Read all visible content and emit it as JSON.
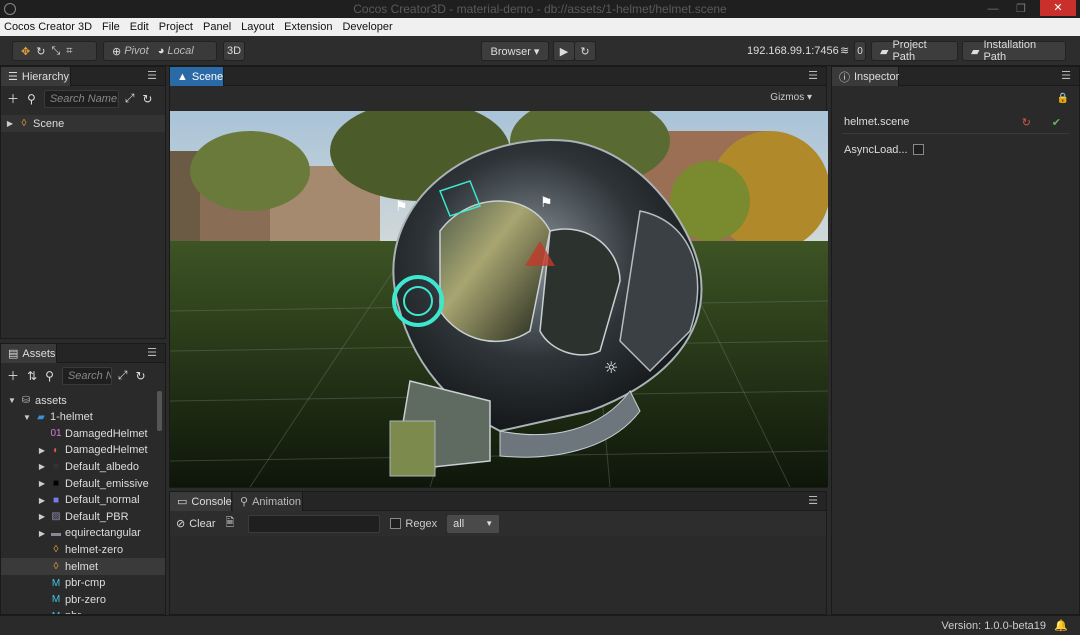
{
  "window": {
    "title": "Cocos Creator3D - material-demo - db://assets/1-helmet/helmet.scene",
    "close_label": "✕",
    "min_label": "—",
    "max_label": "❐"
  },
  "menu": [
    "Cocos Creator 3D",
    "File",
    "Edit",
    "Project",
    "Panel",
    "Layout",
    "Extension",
    "Developer"
  ],
  "toolbar": {
    "pivot_label": "Pivot",
    "local_label": "Local",
    "mode_3d": "3D",
    "browser_label": "Browser ▾",
    "ip_label": "192.168.99.1:7456",
    "connections": "0",
    "project_path_label": "Project Path",
    "installation_path_label": "Installation Path"
  },
  "hierarchy": {
    "tab": "Hierarchy",
    "search_placeholder": "Search Name...",
    "root": "Scene"
  },
  "assets": {
    "tab": "Assets",
    "search_placeholder": "Search N",
    "items": [
      {
        "label": "assets",
        "arrow": "▼",
        "icon": "db",
        "indent": 0
      },
      {
        "label": "1-helmet",
        "arrow": "▼",
        "icon": "folder",
        "indent": 1
      },
      {
        "label": "DamagedHelmet",
        "arrow": "",
        "icon": "mesh",
        "indent": 2
      },
      {
        "label": "DamagedHelmet",
        "arrow": "▶",
        "icon": "gltf",
        "indent": 2
      },
      {
        "label": "Default_albedo",
        "arrow": "▶",
        "icon": "tex-dark",
        "indent": 2
      },
      {
        "label": "Default_emissive",
        "arrow": "▶",
        "icon": "tex-black",
        "indent": 2
      },
      {
        "label": "Default_normal",
        "arrow": "▶",
        "icon": "tex-blue",
        "indent": 2
      },
      {
        "label": "Default_PBR",
        "arrow": "▶",
        "icon": "tex-img",
        "indent": 2
      },
      {
        "label": "equirectangular",
        "arrow": "▶",
        "icon": "tex-strip",
        "indent": 2
      },
      {
        "label": "helmet-zero",
        "arrow": "",
        "icon": "scene",
        "indent": 2
      },
      {
        "label": "helmet",
        "arrow": "",
        "icon": "scene",
        "indent": 2
      },
      {
        "label": "pbr-cmp",
        "arrow": "",
        "icon": "material",
        "indent": 2
      },
      {
        "label": "pbr-zero",
        "arrow": "",
        "icon": "material",
        "indent": 2
      },
      {
        "label": "pbr",
        "arrow": "",
        "icon": "material",
        "indent": 2
      }
    ]
  },
  "scene": {
    "tab": "Scene",
    "gizmos_label": "Gizmos ▾"
  },
  "console": {
    "tab_console": "Console",
    "tab_animation": "Animation",
    "clear_label": "Clear",
    "regex_label": "Regex",
    "level_label": "all"
  },
  "inspector": {
    "tab": "Inspector",
    "title": "helmet.scene",
    "async_label": "AsyncLoad..."
  },
  "footer": {
    "version": "Version: 1.0.0-beta19"
  },
  "colors": {
    "accent": "#2a6aa6",
    "close": "#c9302c",
    "revert": "#d9534f",
    "apply": "#5cb85c",
    "hologram": "#3ee8d0"
  }
}
